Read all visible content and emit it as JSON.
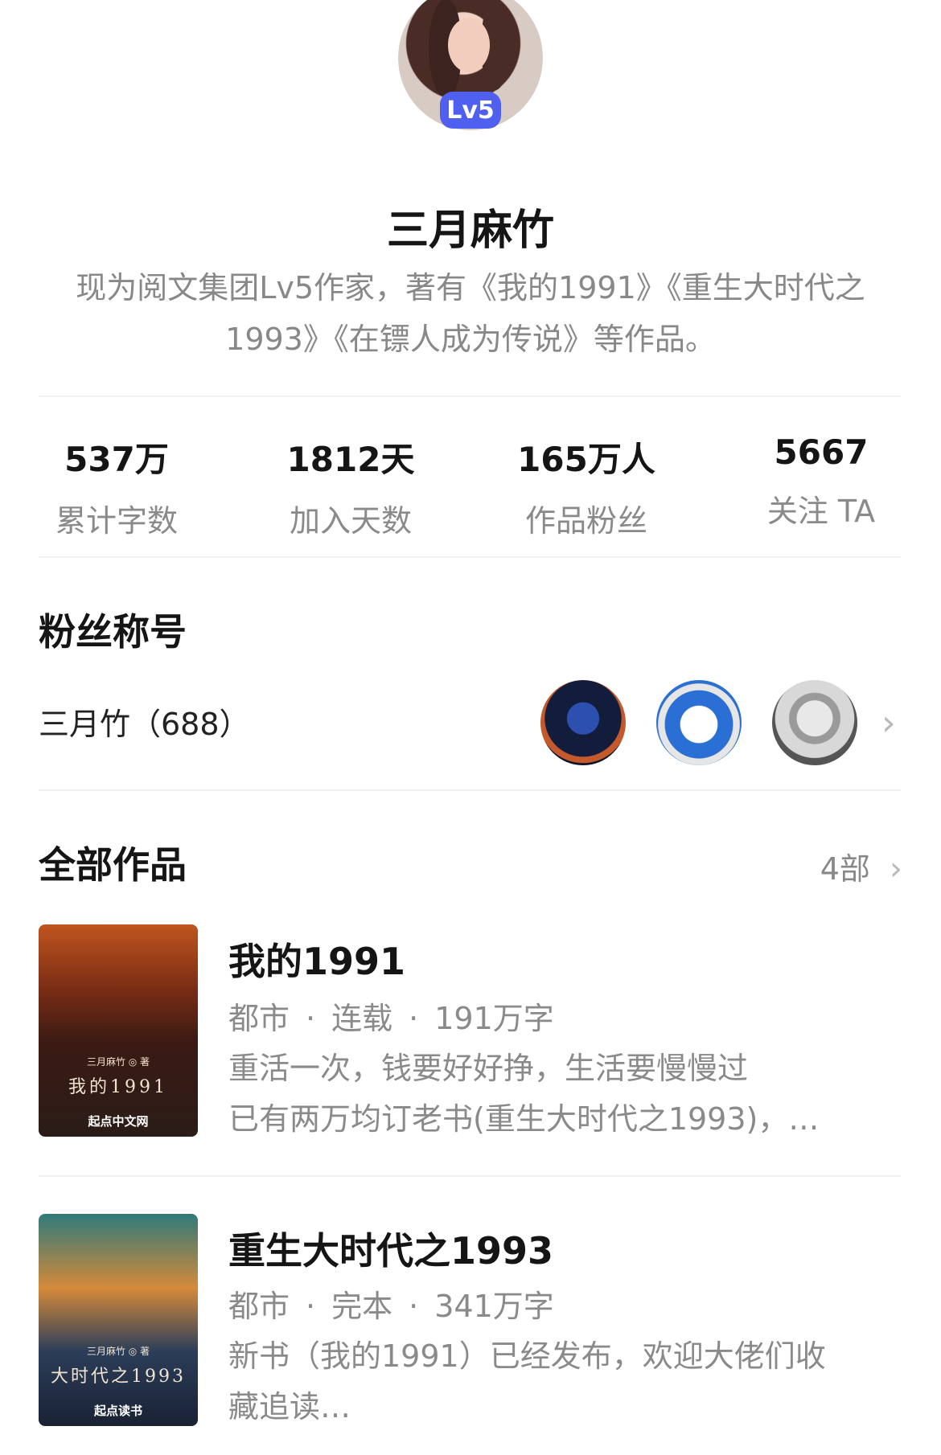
{
  "profile": {
    "level_badge": "Lv5",
    "name": "三月麻竹",
    "bio": "现为阅文集团Lv5作家，著有《我的1991》《重生大时代之1993》《在镖人成为传说》等作品。"
  },
  "stats": [
    {
      "value": "537万",
      "label": "累计字数"
    },
    {
      "value": "1812天",
      "label": "加入天数"
    },
    {
      "value": "165万人",
      "label": "作品粉丝"
    },
    {
      "value": "5667",
      "label": "关注 TA"
    }
  ],
  "fan_section": {
    "title": "粉丝称号",
    "fan_title": "三月竹（688）"
  },
  "works_section": {
    "title": "全部作品",
    "count": "4部"
  },
  "books": [
    {
      "title": "我的1991",
      "genre": "都市",
      "status": "连载",
      "words": "191万字",
      "desc_line1": "重活一次，钱要好好挣，生活要慢慢过",
      "desc_line2": "已有两万均订老书(重生大时代之1993)，…",
      "cover_author": "三月麻竹 ◎ 著",
      "cover_title": "我的1991",
      "cover_logo": "起点中文网"
    },
    {
      "title": "重生大时代之1993",
      "genre": "都市",
      "status": "完本",
      "words": "341万字",
      "desc_line1": "新书（我的1991）已经发布，欢迎大佬们收",
      "desc_line2": "藏追读…",
      "cover_author": "三月麻竹 ◎ 著",
      "cover_title": "大时代之1993",
      "cover_logo": "起点读书"
    }
  ],
  "colors": {
    "badge": "#4f5ff0",
    "text_primary": "#151515",
    "text_secondary": "#8a8a8a",
    "divider": "#f0f0f0"
  },
  "icons": [
    "chevron-right-icon"
  ]
}
